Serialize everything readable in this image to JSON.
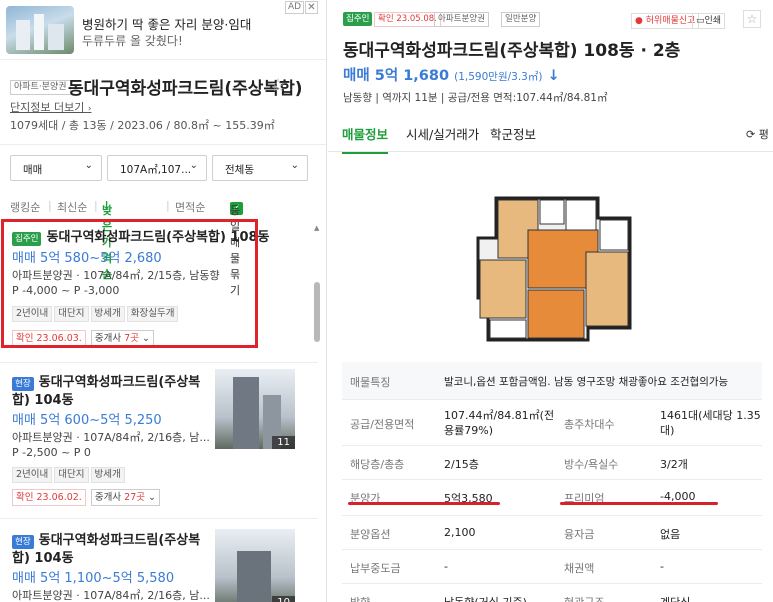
{
  "ad": {
    "title": "병원하기 딱 좋은 자리 분양·임대",
    "subtitle": "두류두류 올 갖췄다!",
    "badge": "AD",
    "close": "✕"
  },
  "complex": {
    "tag": "아파트·분양권",
    "name": "동대구역화성파크드림(주상복합)",
    "more_link": "단지정보 더보기",
    "info": "1079세대 / 총 13동 / 2023.06 / 80.8㎡ ~ 155.39㎡"
  },
  "filters": {
    "trade_type": "매매",
    "area": "107A㎡,107...",
    "building": "전체동"
  },
  "sort": {
    "ranking": "랭킹순",
    "latest": "최신순",
    "low_price": "낮은가격순",
    "area": "면적순",
    "group_label": "동일매물 묶기"
  },
  "listings": [
    {
      "badge": "집주인",
      "title": "동대구역화성파크드림(주상복합) 108동",
      "price": "매매 5억 580~5억 2,680",
      "detail": "아파트분양권 · 107A/84㎡, 2/15층, 남동향",
      "premium": "P -4,000 ~ P -3,000",
      "chips": [
        "2년이내",
        "대단지",
        "방세개",
        "화장실두개"
      ],
      "confirm": "확인 23.06.03.",
      "agents_prefix": "중개사 ",
      "agents_count": "7곳"
    },
    {
      "badge": "현장",
      "title_l1": "동대구역화성파크드림(주상복",
      "title_l2": "합) 104동",
      "price": "매매 5억 600~5억 5,250",
      "detail": "아파트분양권 · 107A/84㎡, 2/16층, 남...",
      "premium": "P -2,500 ~ P 0",
      "chips": [
        "2년이내",
        "대단지",
        "방세개"
      ],
      "confirm": "확인 23.06.02.",
      "agents_prefix": "중개사 ",
      "agents_count": "27곳",
      "photo_count": "11"
    },
    {
      "badge": "현장",
      "title_l1": "동대구역화성파크드림(주상복",
      "title_l2": "합) 104동",
      "price": "매매 5억 1,100~5억 5,580",
      "detail": "아파트분양권 · 107A/84㎡, 2/16층, 남...",
      "photo_count": "10"
    }
  ],
  "detail": {
    "badge": "집주인",
    "confirm": "확인 23.05.08.",
    "tag1": "아파트분양권",
    "tag2": "일반분양",
    "report": "허위매물신고",
    "print": "인쇄",
    "title": "동대구역화성파크드림(주상복합) 108동 · 2층",
    "price": "매매 5억 1,680",
    "price_per": "(1,590만원/3.3㎡)",
    "meta": "남동향 | 역까지 11분 | 공급/전용 면적:107.44㎡/84.81㎡",
    "tabs": [
      "매물정보",
      "시세/실거래가",
      "학군정보"
    ],
    "refresh": "평",
    "rows": {
      "feature_k": "매물특징",
      "feature_v": "발코니,옵션 포함금액임. 남동 영구조망 채광좋아요 조건협의가능",
      "area_k": "공급/전용면적",
      "area_v1": "107.44㎡/84.81㎡(전",
      "area_v2": "용률79%)",
      "households_k": "총주차대수",
      "households_v1": "1461대(세대당 1.35",
      "households_v2": "대)",
      "floor_k": "해당층/총층",
      "floor_v": "2/15층",
      "rooms_k": "방수/욕실수",
      "rooms_v": "3/2개",
      "sale_k": "분양가",
      "sale_v": "5억3,580",
      "premium_k": "프리미엄",
      "premium_v": "-4,000",
      "option_k": "분양옵션",
      "option_v": "2,100",
      "loan_k": "융자금",
      "loan_v": "없음",
      "paid_k": "납부중도금",
      "paid_v": "-",
      "bond_k": "채권액",
      "bond_v": "-",
      "dir_k": "방향",
      "dir_v": "남동향(거실 기준)",
      "entry_k": "현관구조",
      "entry_v": "계단식"
    }
  }
}
